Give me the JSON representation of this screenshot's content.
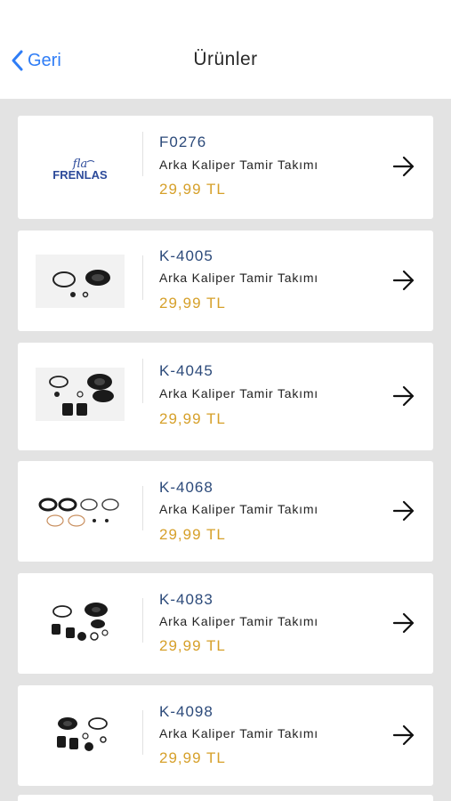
{
  "nav": {
    "back_label": "Geri",
    "title": "Ürünler",
    "accent": "#2f7df6"
  },
  "colors": {
    "code": "#2c4a7a",
    "price": "#d6a02a",
    "background": "#e3e3e3"
  },
  "products": [
    {
      "code": "F0276",
      "name": "Arka Kaliper Tamir Takımı",
      "price": "29,99 TL",
      "image": "frenlas-logo",
      "logo_text": "FRENLAS"
    },
    {
      "code": "K-4005",
      "name": "Arka Kaliper Tamir Takımı",
      "price": "29,99 TL",
      "image": "seal-kit-image"
    },
    {
      "code": "K-4045",
      "name": "Arka Kaliper Tamir Takımı",
      "price": "29,99 TL",
      "image": "seal-kit-image"
    },
    {
      "code": "K-4068",
      "name": "Arka Kaliper Tamir Takımı",
      "price": "29,99 TL",
      "image": "seal-kit-image"
    },
    {
      "code": "K-4083",
      "name": "Arka Kaliper Tamir Takımı",
      "price": "29,99 TL",
      "image": "seal-kit-image"
    },
    {
      "code": "K-4098",
      "name": "Arka Kaliper Tamir Takımı",
      "price": "29,99 TL",
      "image": "seal-kit-image"
    }
  ]
}
